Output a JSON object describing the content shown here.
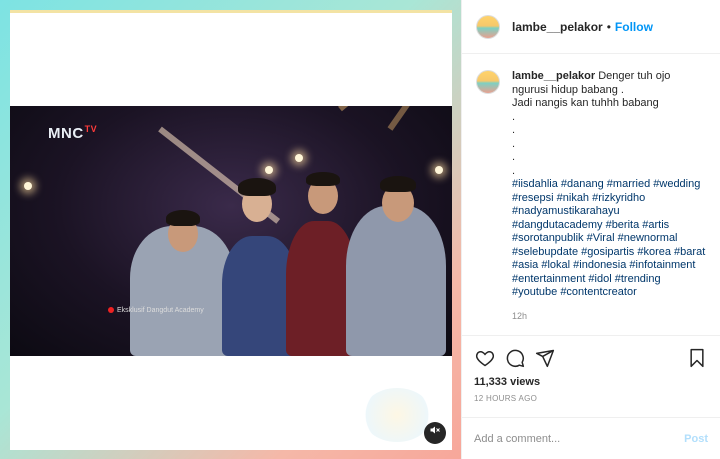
{
  "video": {
    "channel_logo": "MNC",
    "channel_logo_sup": "TV",
    "caption_strip": "Eksklusif Dangdut Academy",
    "mute_icon": "muted-speaker-icon"
  },
  "header": {
    "username": "lambe__pelakor",
    "separator": "•",
    "follow_label": "Follow"
  },
  "caption": {
    "username": "lambe__pelakor",
    "lines": [
      "Denger tuh ojo",
      "ngurusi hidup babang .",
      "Jadi nangis kan tuhhh babang",
      ".",
      ".",
      ".",
      ".",
      "."
    ],
    "hashtags": "#iisdahlia #danang #married #wedding #resepsi #nikah #rizkyridho #nadyamustikarahayu #dangdutacademy #berita #artis #sorotanpublik #Viral #newnormal #selebupdate #gosipartis #korea #barat #asia #lokal #indonesia #infotainment #entertainment #idol #trending #youtube #contentcreator",
    "time": "12h"
  },
  "actions": {
    "icons": [
      "heart-icon",
      "comment-icon",
      "share-icon",
      "bookmark-icon"
    ],
    "views": "11,333 views",
    "ago": "12 HOURS AGO"
  },
  "comment": {
    "placeholder": "Add a comment...",
    "post_label": "Post"
  },
  "colors": {
    "accent": "#0095f6",
    "post_disabled": "#b2dffc",
    "hashtag": "#00376b"
  }
}
